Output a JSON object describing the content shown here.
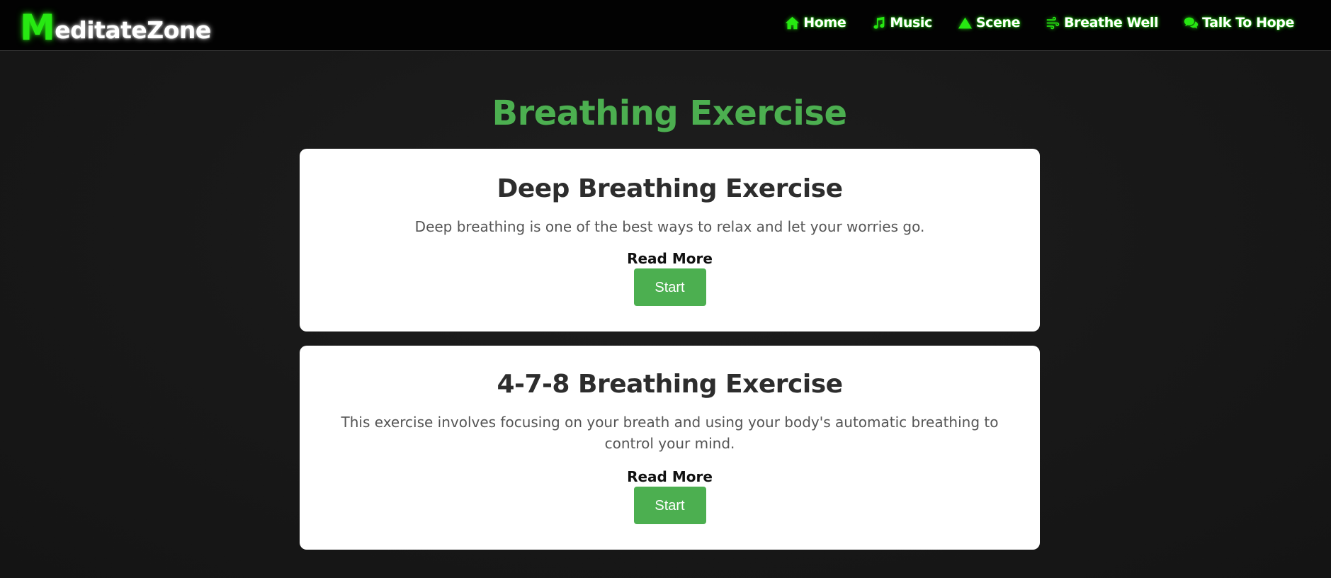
{
  "brand": {
    "first_letter": "M",
    "rest": "editateZone",
    "accent_color": "#27e812"
  },
  "nav": {
    "items": [
      {
        "label": "Home",
        "icon": "home-icon"
      },
      {
        "label": "Music",
        "icon": "music-icon"
      },
      {
        "label": "Scene",
        "icon": "triangle-icon"
      },
      {
        "label": "Breathe Well",
        "icon": "wind-icon"
      },
      {
        "label": "Talk To Hope",
        "icon": "chat-icon"
      }
    ]
  },
  "page": {
    "title": "Breathing Exercise",
    "title_color": "#4caf50"
  },
  "exercises": [
    {
      "title": "Deep Breathing Exercise",
      "description": "Deep breathing is one of the best ways to relax and let your worries go.",
      "read_more": "Read More",
      "button": "Start"
    },
    {
      "title": "4-7-8 Breathing Exercise",
      "description": "This exercise involves focusing on your breath and using your body's automatic breathing to control your mind.",
      "read_more": "Read More",
      "button": "Start"
    }
  ]
}
